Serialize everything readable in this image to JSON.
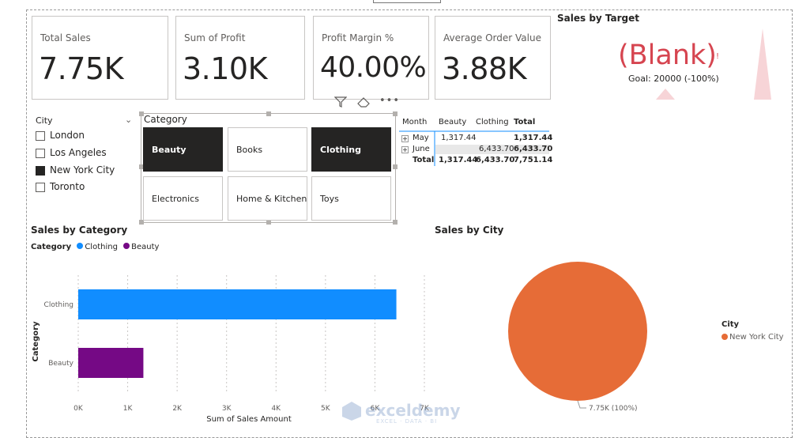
{
  "kpis": [
    {
      "label": "Total Sales",
      "value": "7.75K"
    },
    {
      "label": "Sum of Profit",
      "value": "3.10K"
    },
    {
      "label": "Profit Margin %",
      "value": "40.00%"
    },
    {
      "label": "Average Order Value",
      "value": "3.88K"
    }
  ],
  "gauge": {
    "title": "Sales by Target",
    "value_text": "(Blank)",
    "goal_text": "Goal: 20000 (-100%)",
    "color": "#d64550"
  },
  "city_slicer": {
    "header": "City",
    "chevron_icon": "chevron-down-icon",
    "items": [
      {
        "label": "London",
        "checked": false
      },
      {
        "label": "Los Angeles",
        "checked": false
      },
      {
        "label": "New York City",
        "checked": true
      },
      {
        "label": "Toronto",
        "checked": false
      }
    ]
  },
  "category_slicer": {
    "title": "Category",
    "tiles": [
      {
        "label": "Beauty",
        "selected": true
      },
      {
        "label": "Books",
        "selected": false
      },
      {
        "label": "Clothing",
        "selected": true
      },
      {
        "label": "Electronics",
        "selected": false
      },
      {
        "label": "Home & Kitchen",
        "selected": false
      },
      {
        "label": "Toys",
        "selected": false
      }
    ],
    "icons": [
      "filter-icon",
      "eraser-icon",
      "more-options-icon"
    ]
  },
  "matrix": {
    "headers": [
      "Month",
      "Beauty",
      "Clothing",
      "Total"
    ],
    "rows": [
      {
        "label": "May",
        "cells": [
          "1,317.44",
          "",
          "1,317.44"
        ]
      },
      {
        "label": "June",
        "cells": [
          "",
          "6,433.70",
          "6,433.70"
        ]
      },
      {
        "label": "Total",
        "cells": [
          "1,317.44",
          "6,433.70",
          "7,751.14"
        ]
      }
    ],
    "expand_icon": "expand-plus-icon"
  },
  "bar_chart": {
    "title": "Sales by Category",
    "legend_title": "Category",
    "legend_items": [
      {
        "label": "Clothing",
        "color": "#118dff"
      },
      {
        "label": "Beauty",
        "color": "#750985"
      }
    ]
  },
  "pie_chart": {
    "title": "Sales by City",
    "legend_title": "City",
    "legend_items": [
      {
        "label": "New York City",
        "color": "#e66c37"
      }
    ],
    "data_label": "7.75K (100%)"
  },
  "watermark": {
    "name": "exceldemy",
    "sub": "EXCEL · DATA · BI"
  },
  "chart_data": [
    {
      "type": "bar",
      "orientation": "horizontal",
      "categories": [
        "Clothing",
        "Beauty"
      ],
      "values": [
        6433.7,
        1317.44
      ],
      "colors": [
        "#118dff",
        "#750985"
      ],
      "title": "Sales by Category",
      "xlabel": "Sum of Sales Amount",
      "ylabel": "Category",
      "xlim": [
        0,
        7000
      ],
      "xticks": [
        "0K",
        "1K",
        "2K",
        "3K",
        "4K",
        "5K",
        "6K",
        "7K"
      ],
      "legend": "top-left"
    },
    {
      "type": "pie",
      "categories": [
        "New York City"
      ],
      "values": [
        7751.14
      ],
      "colors": [
        "#e66c37"
      ],
      "title": "Sales by City",
      "legend": "right"
    }
  ]
}
